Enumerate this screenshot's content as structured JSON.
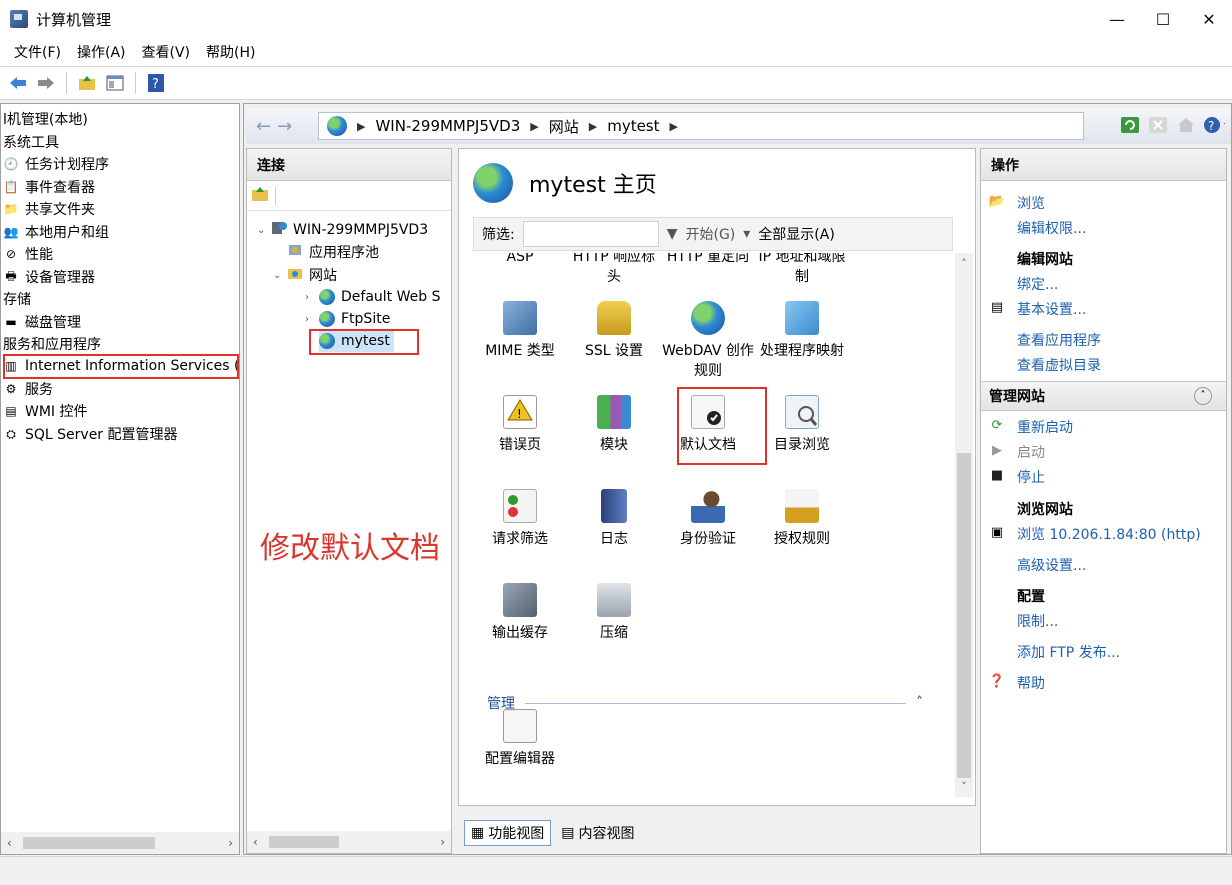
{
  "window": {
    "title": "计算机管理",
    "minimize": "—",
    "maximize": "☐",
    "close": "✕"
  },
  "menu": [
    "文件(F)",
    "操作(A)",
    "查看(V)",
    "帮助(H)"
  ],
  "mmc_tree": [
    "l机管理(本地)",
    "系统工具",
    "任务计划程序",
    "事件查看器",
    "共享文件夹",
    "本地用户和组",
    "性能",
    "设备管理器",
    "存储",
    "磁盘管理",
    "服务和应用程序",
    "Internet Information Services (II",
    "服务",
    "WMI 控件",
    "SQL Server 配置管理器"
  ],
  "address": {
    "host": "WIN-299MMPJ5VD3",
    "sites": "网站",
    "site": "mytest"
  },
  "connections": {
    "title": "连接",
    "tree": [
      "WIN-299MMPJ5VD3",
      "应用程序池",
      "网站",
      "Default Web S",
      "FtpSite",
      "mytest"
    ]
  },
  "center": {
    "title": "mytest 主页",
    "filter_label": "筛选:",
    "start_label": "开始(G)",
    "show_all_label": "全部显示(A)",
    "features": [
      "ASP",
      "HTTP 响应标头",
      "HTTP 重定向",
      "IP 地址和域限制",
      "MIME 类型",
      "SSL 设置",
      "WebDAV 创作规则",
      "处理程序映射",
      "错误页",
      "模块",
      "默认文档",
      "目录浏览",
      "请求筛选",
      "日志",
      "身份验证",
      "授权规则",
      "输出缓存",
      "压缩"
    ],
    "group_manage": "管理",
    "manage_features": [
      "配置编辑器"
    ],
    "tabs": {
      "features_view": "功能视图",
      "content_view": "内容视图"
    }
  },
  "actions": {
    "title": "操作",
    "browse": "浏览",
    "edit_perms": "编辑权限...",
    "edit_site_head": "编辑网站",
    "bindings": "绑定...",
    "basic_settings": "基本设置...",
    "view_apps": "查看应用程序",
    "view_vdirs": "查看虚拟目录",
    "manage_site_head": "管理网站",
    "restart": "重新启动",
    "start": "启动",
    "stop": "停止",
    "browse_site_head": "浏览网站",
    "browse_url": "浏览 10.206.1.84:80 (http)",
    "advanced": "高级设置...",
    "config_head": "配置",
    "limits": "限制...",
    "add_ftp": "添加 FTP 发布...",
    "help": "帮助"
  },
  "annotation": "修改默认文档"
}
